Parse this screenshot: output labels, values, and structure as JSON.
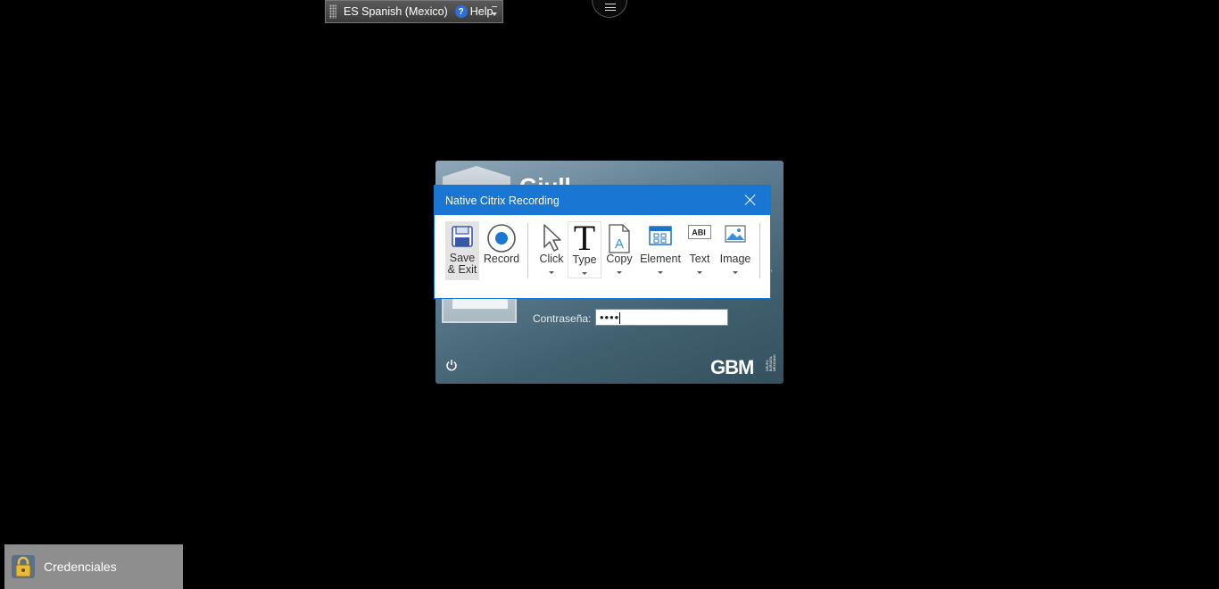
{
  "language_bar": {
    "language": "ES Spanish (Mexico)",
    "help_label": "Help"
  },
  "login": {
    "welcome_partial": "Giull",
    "password_label": "Contraseña:",
    "password_masked": "••••",
    "brand": "GBM",
    "brand_small": "GRUPO BURSÁTIL MEXICANO"
  },
  "recorder": {
    "title": "Native Citrix Recording",
    "tools": [
      {
        "label": "Save\n& Exit",
        "icon": "save-icon"
      },
      {
        "label": "Record",
        "icon": "record-icon"
      },
      {
        "label": "Click",
        "icon": "cursor-icon",
        "dropdown": true
      },
      {
        "label": "Type",
        "icon": "type-icon",
        "dropdown": true
      },
      {
        "label": "Copy",
        "icon": "copy-icon",
        "dropdown": true
      },
      {
        "label": "Element",
        "icon": "element-icon",
        "dropdown": true
      },
      {
        "label": "Text",
        "icon": "text-icon",
        "dropdown": true
      },
      {
        "label": "Image",
        "icon": "image-icon",
        "dropdown": true
      }
    ],
    "text_icon_glyph": "ABI"
  },
  "taskbar": {
    "item_label": "Credenciales"
  },
  "colors": {
    "dialog_accent": "#1977d3",
    "desktop_bg": "#000000",
    "taskbar_item_bg": "#8e8e8e"
  }
}
